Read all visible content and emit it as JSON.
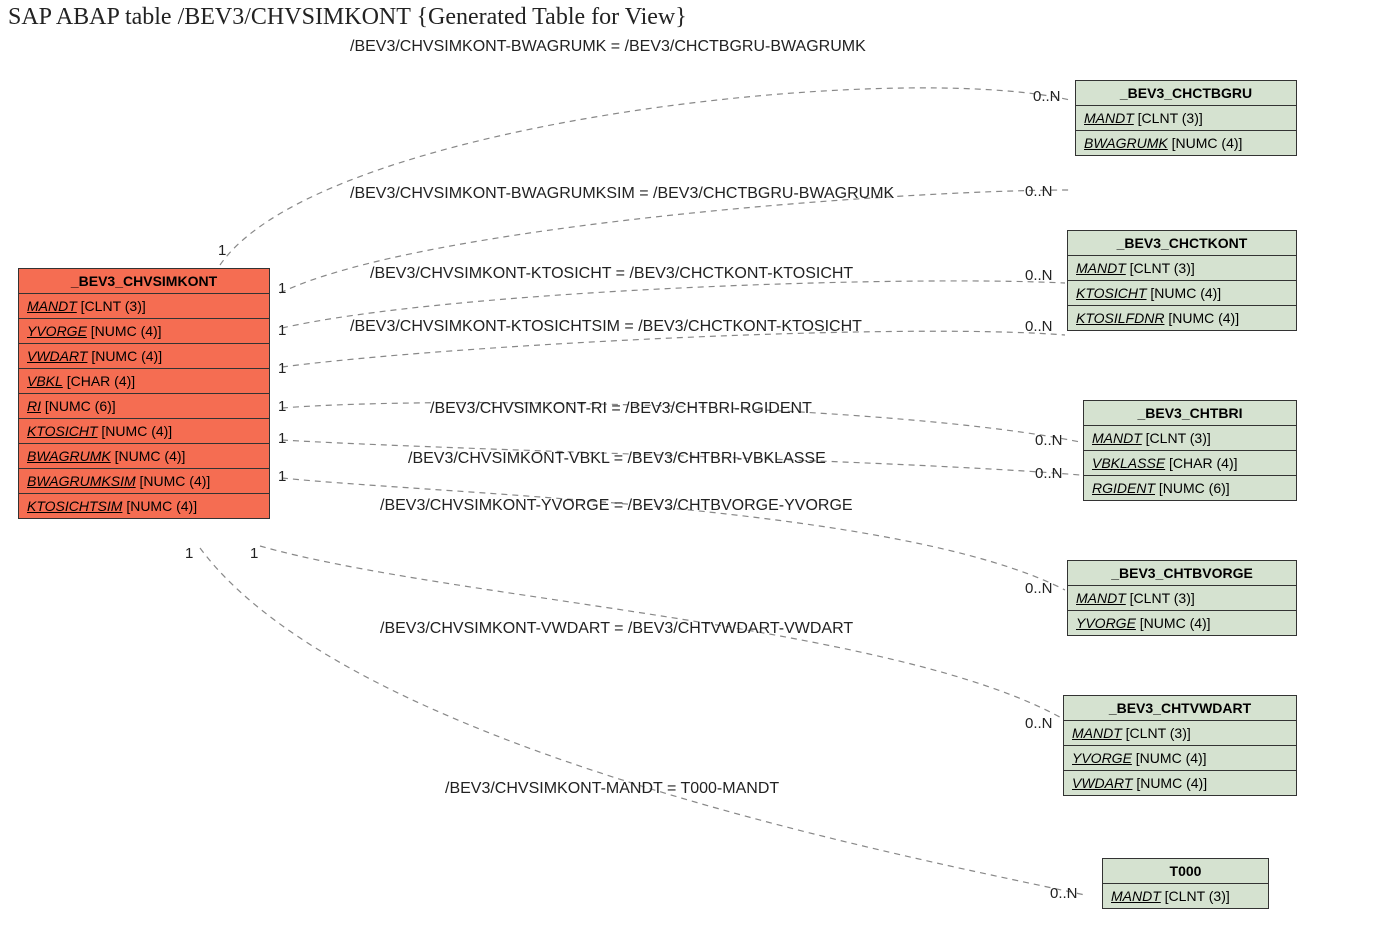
{
  "title": "SAP ABAP table /BEV3/CHVSIMKONT {Generated Table for View}",
  "sourceTable": {
    "name": "_BEV3_CHVSIMKONT",
    "fields": [
      {
        "name": "MANDT",
        "type": "[CLNT (3)]"
      },
      {
        "name": "YVORGE",
        "type": "[NUMC (4)]"
      },
      {
        "name": "VWDART",
        "type": "[NUMC (4)]"
      },
      {
        "name": "VBKL",
        "type": "[CHAR (4)]"
      },
      {
        "name": "RI",
        "type": "[NUMC (6)]"
      },
      {
        "name": "KTOSICHT",
        "type": "[NUMC (4)]"
      },
      {
        "name": "BWAGRUMK",
        "type": "[NUMC (4)]"
      },
      {
        "name": "BWAGRUMKSIM",
        "type": "[NUMC (4)]"
      },
      {
        "name": "KTOSICHTSIM",
        "type": "[NUMC (4)]"
      }
    ]
  },
  "targets": [
    {
      "name": "_BEV3_CHCTBGRU",
      "fields": [
        {
          "name": "MANDT",
          "type": "[CLNT (3)]"
        },
        {
          "name": "BWAGRUMK",
          "type": "[NUMC (4)]"
        }
      ]
    },
    {
      "name": "_BEV3_CHCTKONT",
      "fields": [
        {
          "name": "MANDT",
          "type": "[CLNT (3)]"
        },
        {
          "name": "KTOSICHT",
          "type": "[NUMC (4)]"
        },
        {
          "name": "KTOSILFDNR",
          "type": "[NUMC (4)]"
        }
      ]
    },
    {
      "name": "_BEV3_CHTBRI",
      "fields": [
        {
          "name": "MANDT",
          "type": "[CLNT (3)]"
        },
        {
          "name": "VBKLASSE",
          "type": "[CHAR (4)]"
        },
        {
          "name": "RGIDENT",
          "type": "[NUMC (6)]"
        }
      ]
    },
    {
      "name": "_BEV3_CHTBVORGE",
      "fields": [
        {
          "name": "MANDT",
          "type": "[CLNT (3)]"
        },
        {
          "name": "YVORGE",
          "type": "[NUMC (4)]"
        }
      ]
    },
    {
      "name": "_BEV3_CHTVWDART",
      "fields": [
        {
          "name": "MANDT",
          "type": "[CLNT (3)]"
        },
        {
          "name": "YVORGE",
          "type": "[NUMC (4)]"
        },
        {
          "name": "VWDART",
          "type": "[NUMC (4)]"
        }
      ]
    },
    {
      "name": "T000",
      "fields": [
        {
          "name": "MANDT",
          "type": "[CLNT (3)]"
        }
      ]
    }
  ],
  "relations": [
    {
      "label": "/BEV3/CHVSIMKONT-BWAGRUMK = /BEV3/CHCTBGRU-BWAGRUMK",
      "lc": "1",
      "rc": "0..N"
    },
    {
      "label": "/BEV3/CHVSIMKONT-BWAGRUMKSIM = /BEV3/CHCTBGRU-BWAGRUMK",
      "lc": "1",
      "rc": "0..N"
    },
    {
      "label": "/BEV3/CHVSIMKONT-KTOSICHT = /BEV3/CHCTKONT-KTOSICHT",
      "lc": "1",
      "rc": "0..N"
    },
    {
      "label": "/BEV3/CHVSIMKONT-KTOSICHTSIM = /BEV3/CHCTKONT-KTOSICHT",
      "lc": "1",
      "rc": "0..N"
    },
    {
      "label": "/BEV3/CHVSIMKONT-RI = /BEV3/CHTBRI-RGIDENT",
      "lc": "1",
      "rc": "0..N"
    },
    {
      "label": "/BEV3/CHVSIMKONT-VBKL = /BEV3/CHTBRI-VBKLASSE",
      "lc": "1",
      "rc": "0..N"
    },
    {
      "label": "/BEV3/CHVSIMKONT-YVORGE = /BEV3/CHTBVORGE-YVORGE",
      "lc": "1",
      "rc": "0..N"
    },
    {
      "label": "/BEV3/CHVSIMKONT-VWDART = /BEV3/CHTVWDART-VWDART",
      "lc": "1",
      "rc": "0..N"
    },
    {
      "label": "/BEV3/CHVSIMKONT-MANDT = T000-MANDT",
      "lc": "1",
      "rc": "0..N"
    }
  ],
  "card": {
    "one": "1",
    "many": "0..N"
  }
}
